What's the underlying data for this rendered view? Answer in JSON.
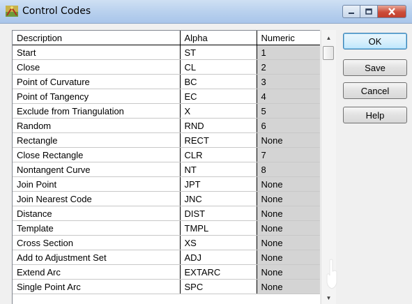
{
  "window": {
    "title": "Control Codes"
  },
  "grid": {
    "headers": [
      "Description",
      "Alpha",
      "Numeric"
    ],
    "rows": [
      [
        "Start",
        "ST",
        "1"
      ],
      [
        "Close",
        "CL",
        "2"
      ],
      [
        "Point of Curvature",
        "BC",
        "3"
      ],
      [
        "Point of Tangency",
        "EC",
        "4"
      ],
      [
        "Exclude from Triangulation",
        "X",
        "5"
      ],
      [
        "Random",
        "RND",
        "6"
      ],
      [
        "Rectangle",
        "RECT",
        "None"
      ],
      [
        "Close Rectangle",
        "CLR",
        "7"
      ],
      [
        "Nontangent Curve",
        "NT",
        "8"
      ],
      [
        "Join Point",
        "JPT",
        "None"
      ],
      [
        "Join Nearest Code",
        "JNC",
        "None"
      ],
      [
        "Distance",
        "DIST",
        "None"
      ],
      [
        "Template",
        "TMPL",
        "None"
      ],
      [
        "Cross Section",
        "XS",
        "None"
      ],
      [
        "Add to Adjustment Set",
        "ADJ",
        "None"
      ],
      [
        "Extend Arc",
        "EXTARC",
        "None"
      ],
      [
        "Single Point Arc",
        "SPC",
        "None"
      ]
    ]
  },
  "buttons": {
    "ok": "OK",
    "save": "Save",
    "cancel": "Cancel",
    "help": "Help"
  },
  "icons": {
    "app": "surveying-app-icon",
    "minimize": "minimize-icon",
    "maximize": "maximize-icon",
    "close": "close-icon"
  },
  "colors": {
    "titlebar": "#b9d1ee",
    "close_button": "#cc4d3a",
    "numeric_column": "#d4d4d4",
    "default_button_border": "#3c7fb1"
  }
}
